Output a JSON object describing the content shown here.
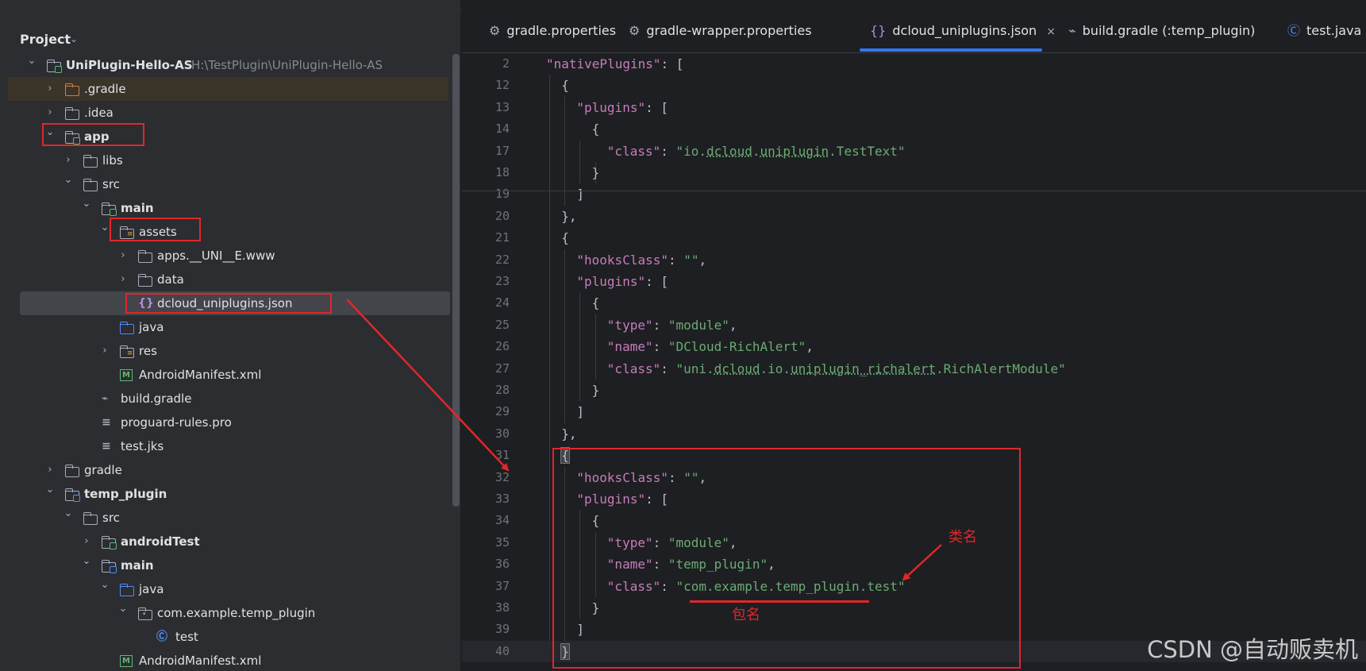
{
  "project_panel": {
    "title": "Project",
    "tree": [
      {
        "label": "UniPlugin-Hello-AS",
        "hint": "H:\\TestPlugin\\UniPlugin-Hello-AS",
        "bold": true,
        "depth": 0,
        "arrow": "expanded",
        "icon": "module-folder"
      },
      {
        "label": ".gradle",
        "depth": 1,
        "arrow": "collapsed",
        "icon": "folder-orange"
      },
      {
        "label": ".idea",
        "depth": 1,
        "arrow": "collapsed",
        "icon": "folder"
      },
      {
        "label": "app",
        "bold": true,
        "depth": 1,
        "arrow": "expanded",
        "icon": "module-folder"
      },
      {
        "label": "libs",
        "depth": 2,
        "arrow": "collapsed",
        "icon": "folder"
      },
      {
        "label": "src",
        "depth": 2,
        "arrow": "expanded",
        "icon": "folder"
      },
      {
        "label": "main",
        "bold": true,
        "depth": 3,
        "arrow": "expanded",
        "icon": "module-folder"
      },
      {
        "label": "assets",
        "depth": 4,
        "arrow": "expanded",
        "icon": "resource-folder"
      },
      {
        "label": "apps.__UNI__E.www",
        "depth": 5,
        "arrow": "collapsed",
        "icon": "folder"
      },
      {
        "label": "data",
        "depth": 5,
        "arrow": "collapsed",
        "icon": "folder"
      },
      {
        "label": "dcloud_uniplugins.json",
        "depth": 5,
        "arrow": "none",
        "icon": "json-file",
        "selected": true
      },
      {
        "label": "java",
        "depth": 4,
        "arrow": "none",
        "icon": "folder-blue"
      },
      {
        "label": "res",
        "depth": 4,
        "arrow": "collapsed",
        "icon": "resource-folder"
      },
      {
        "label": "AndroidManifest.xml",
        "depth": 4,
        "arrow": "none",
        "icon": "manifest-file"
      },
      {
        "label": "build.gradle",
        "depth": 3,
        "arrow": "none",
        "icon": "gradle-file"
      },
      {
        "label": "proguard-rules.pro",
        "depth": 3,
        "arrow": "none",
        "icon": "text-file"
      },
      {
        "label": "test.jks",
        "depth": 3,
        "arrow": "none",
        "icon": "text-file"
      },
      {
        "label": "gradle",
        "depth": 1,
        "arrow": "collapsed",
        "icon": "folder"
      },
      {
        "label": "temp_plugin",
        "bold": true,
        "depth": 1,
        "arrow": "expanded",
        "icon": "module-folder-blue"
      },
      {
        "label": "src",
        "depth": 2,
        "arrow": "expanded",
        "icon": "folder"
      },
      {
        "label": "androidTest",
        "bold": true,
        "depth": 3,
        "arrow": "collapsed",
        "icon": "module-folder"
      },
      {
        "label": "main",
        "bold": true,
        "depth": 3,
        "arrow": "expanded",
        "icon": "module-folder-blue"
      },
      {
        "label": "java",
        "depth": 4,
        "arrow": "expanded",
        "icon": "folder-blue"
      },
      {
        "label": "com.example.temp_plugin",
        "depth": 5,
        "arrow": "expanded",
        "icon": "package-folder"
      },
      {
        "label": "test",
        "depth": 6,
        "arrow": "none",
        "icon": "class-file"
      },
      {
        "label": "AndroidManifest.xml",
        "depth": 4,
        "arrow": "none",
        "icon": "manifest-file"
      }
    ]
  },
  "tabs": [
    {
      "label": "gradle.properties",
      "icon": "gear-icon"
    },
    {
      "label": "gradle-wrapper.properties",
      "icon": "gear-icon"
    },
    {
      "label": "dcloud_uniplugins.json",
      "icon": "json-icon",
      "active": true,
      "close": "×"
    },
    {
      "label": "build.gradle (:temp_plugin)",
      "icon": "gradle-icon"
    },
    {
      "label": "test.java",
      "icon": "class-icon"
    }
  ],
  "code_lines": [
    {
      "num": "2",
      "indent": 2,
      "tokens": [
        [
          "k",
          "\"nativePlugins\""
        ],
        [
          "p",
          ": ["
        ]
      ]
    },
    {
      "num": "12",
      "indent": 3,
      "tokens": [
        [
          "p",
          "{"
        ]
      ]
    },
    {
      "num": "13",
      "indent": 4,
      "tokens": [
        [
          "k",
          "\"plugins\""
        ],
        [
          "p",
          ": ["
        ]
      ]
    },
    {
      "num": "14",
      "indent": 5,
      "tokens": [
        [
          "p",
          "{"
        ]
      ]
    },
    {
      "num": "17",
      "indent": 6,
      "tokens": [
        [
          "k",
          "\"class\""
        ],
        [
          "p",
          ": "
        ],
        [
          "s",
          "\"io.dcloud.uniplugin.TestText\""
        ]
      ]
    },
    {
      "num": "18",
      "indent": 5,
      "tokens": [
        [
          "p",
          "}"
        ]
      ]
    },
    {
      "num": "19",
      "indent": 4,
      "tokens": [
        [
          "p",
          "]"
        ]
      ]
    },
    {
      "num": "20",
      "indent": 3,
      "tokens": [
        [
          "p",
          "},"
        ]
      ]
    },
    {
      "num": "21",
      "indent": 3,
      "tokens": [
        [
          "p",
          "{"
        ]
      ]
    },
    {
      "num": "22",
      "indent": 4,
      "tokens": [
        [
          "k",
          "\"hooksClass\""
        ],
        [
          "p",
          ": "
        ],
        [
          "s",
          "\"\""
        ],
        [
          "p",
          ","
        ]
      ]
    },
    {
      "num": "23",
      "indent": 4,
      "tokens": [
        [
          "k",
          "\"plugins\""
        ],
        [
          "p",
          ": ["
        ]
      ]
    },
    {
      "num": "24",
      "indent": 5,
      "tokens": [
        [
          "p",
          "{"
        ]
      ]
    },
    {
      "num": "25",
      "indent": 6,
      "tokens": [
        [
          "k",
          "\"type\""
        ],
        [
          "p",
          ": "
        ],
        [
          "s",
          "\"module\""
        ],
        [
          "p",
          ","
        ]
      ]
    },
    {
      "num": "26",
      "indent": 6,
      "tokens": [
        [
          "k",
          "\"name\""
        ],
        [
          "p",
          ": "
        ],
        [
          "s",
          "\"DCloud-RichAlert\""
        ],
        [
          "p",
          ","
        ]
      ]
    },
    {
      "num": "27",
      "indent": 6,
      "tokens": [
        [
          "k",
          "\"class\""
        ],
        [
          "p",
          ": "
        ],
        [
          "s",
          "\"uni.dcloud.io.uniplugin_richalert.RichAlertModule\""
        ]
      ]
    },
    {
      "num": "28",
      "indent": 5,
      "tokens": [
        [
          "p",
          "}"
        ]
      ]
    },
    {
      "num": "29",
      "indent": 4,
      "tokens": [
        [
          "p",
          "]"
        ]
      ]
    },
    {
      "num": "30",
      "indent": 3,
      "tokens": [
        [
          "p",
          "},"
        ]
      ]
    },
    {
      "num": "31",
      "indent": 3,
      "tokens": [
        [
          "b",
          "{"
        ]
      ]
    },
    {
      "num": "32",
      "indent": 4,
      "tokens": [
        [
          "k",
          "\"hooksClass\""
        ],
        [
          "p",
          ": "
        ],
        [
          "s",
          "\"\""
        ],
        [
          "p",
          ","
        ]
      ]
    },
    {
      "num": "33",
      "indent": 4,
      "tokens": [
        [
          "k",
          "\"plugins\""
        ],
        [
          "p",
          ": ["
        ]
      ]
    },
    {
      "num": "34",
      "indent": 5,
      "tokens": [
        [
          "p",
          "{"
        ]
      ]
    },
    {
      "num": "35",
      "indent": 6,
      "tokens": [
        [
          "k",
          "\"type\""
        ],
        [
          "p",
          ": "
        ],
        [
          "s",
          "\"module\""
        ],
        [
          "p",
          ","
        ]
      ]
    },
    {
      "num": "36",
      "indent": 6,
      "tokens": [
        [
          "k",
          "\"name\""
        ],
        [
          "p",
          ": "
        ],
        [
          "s",
          "\"temp_plugin\""
        ],
        [
          "p",
          ","
        ]
      ]
    },
    {
      "num": "37",
      "indent": 6,
      "tokens": [
        [
          "k",
          "\"class\""
        ],
        [
          "p",
          ": "
        ],
        [
          "s",
          "\"com.example.temp_plugin.test\""
        ]
      ]
    },
    {
      "num": "38",
      "indent": 5,
      "tokens": [
        [
          "p",
          "}"
        ]
      ]
    },
    {
      "num": "39",
      "indent": 4,
      "tokens": [
        [
          "p",
          "]"
        ]
      ]
    },
    {
      "num": "40",
      "indent": 3,
      "tokens": [
        [
          "b",
          "}"
        ]
      ],
      "current": true
    }
  ],
  "annotations": {
    "class_name": "类名",
    "package_name": "包名"
  },
  "watermark": "CSDN @自动贩卖机",
  "colors": {
    "annotation_red": "#e0272a",
    "accent_blue": "#3574f0"
  }
}
